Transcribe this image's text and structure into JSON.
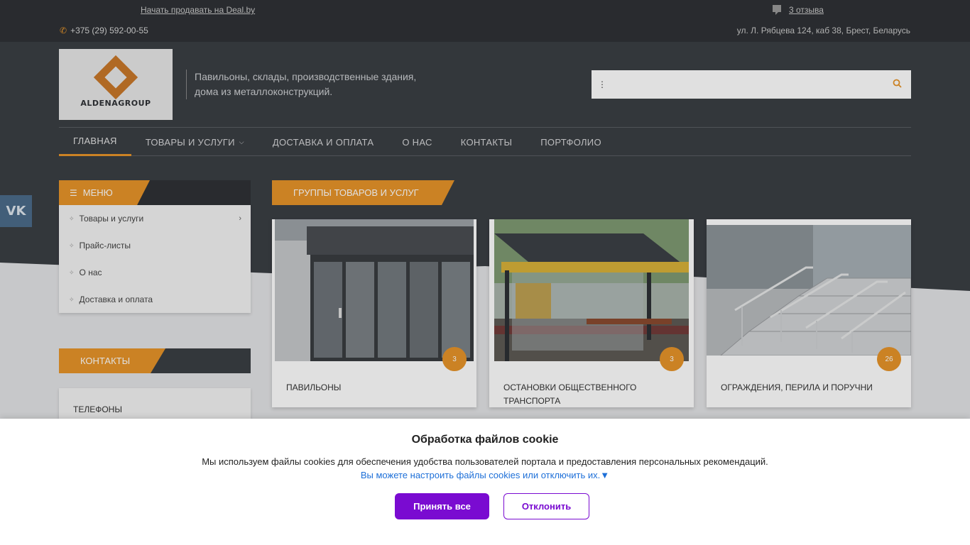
{
  "topbar": {
    "sell_link": "Начать продавать на Deal.by",
    "reviews": "3 отзыва",
    "phone": "+375 (29) 592-00-55",
    "address": "ул. Л. Рябцева 124, каб 38, Брест, Беларусь"
  },
  "logo": {
    "text": "ALDENAGROUP"
  },
  "tagline": "Павильоны, склады, производственные здания, дома из металлоконструкций.",
  "search": {
    "placeholder": ""
  },
  "nav": [
    {
      "label": "Главная"
    },
    {
      "label": "Товары и услуги"
    },
    {
      "label": "Доставка и оплата"
    },
    {
      "label": "О нас"
    },
    {
      "label": "Контакты"
    },
    {
      "label": "Портфолио"
    }
  ],
  "vk": {
    "label": "VK"
  },
  "sidebar": {
    "menu_title": "Меню",
    "items": [
      {
        "label": "Товары и услуги"
      },
      {
        "label": "Прайс-листы"
      },
      {
        "label": "О нас"
      },
      {
        "label": "Доставка и оплата"
      }
    ],
    "contacts_title": "Контакты",
    "phones_label": "Телефоны"
  },
  "groups": {
    "title": "Группы товаров и услуг",
    "cards": [
      {
        "title": "Павильоны",
        "count": "3"
      },
      {
        "title": "Остановки общественного транспорта",
        "count": "3"
      },
      {
        "title": "Ограждения, перила и поручни",
        "count": "26"
      }
    ]
  },
  "cookie": {
    "title": "Обработка файлов cookie",
    "description": "Мы используем файлы cookies для обеспечения удобства пользователей портала и предоставления персональных рекомендаций.",
    "settings_link": "Вы можете настроить файлы cookies или отключить их.▼",
    "accept": "Принять все",
    "decline": "Отклонить"
  },
  "colors": {
    "accent": "#e8952a",
    "dark": "#2f3236",
    "cookie_button": "#7a0bd1"
  }
}
